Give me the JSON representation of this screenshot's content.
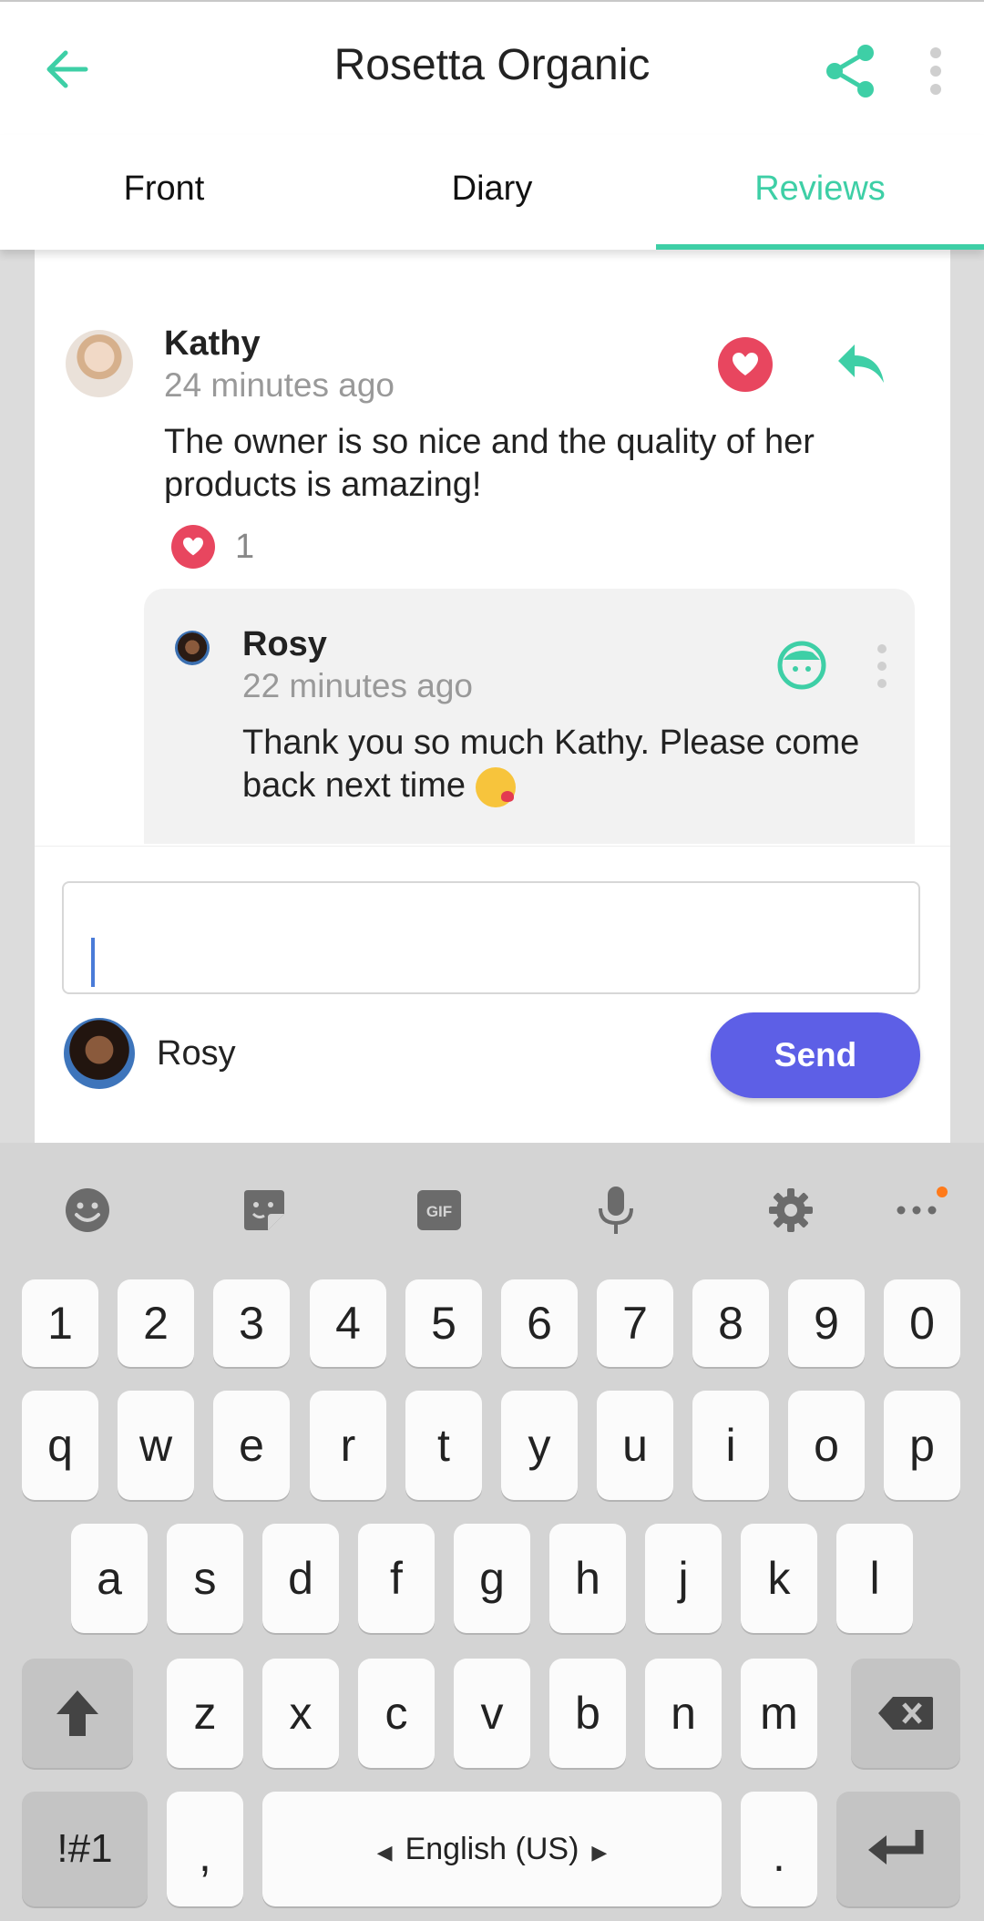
{
  "header": {
    "title": "Rosetta Organic"
  },
  "tabs": [
    {
      "label": "Front"
    },
    {
      "label": "Diary"
    },
    {
      "label": "Reviews"
    }
  ],
  "review": {
    "author": "Kathy",
    "time": "24 minutes ago",
    "text": "The owner is so nice and the quality of her products is amazing!",
    "likes": "1"
  },
  "reply": {
    "author": "Rosy",
    "time": "22 minutes ago",
    "text": "Thank you so much Kathy. Please come back next time"
  },
  "compose": {
    "user": "Rosy",
    "input_value": "",
    "send_label": "Send"
  },
  "keyboard": {
    "numbers": [
      "1",
      "2",
      "3",
      "4",
      "5",
      "6",
      "7",
      "8",
      "9",
      "0"
    ],
    "row1": [
      "q",
      "w",
      "e",
      "r",
      "t",
      "y",
      "u",
      "i",
      "o",
      "p"
    ],
    "row2": [
      "a",
      "s",
      "d",
      "f",
      "g",
      "h",
      "j",
      "k",
      "l"
    ],
    "row3": [
      "z",
      "x",
      "c",
      "v",
      "b",
      "n",
      "m"
    ],
    "symbols_label": "!#1",
    "comma": ",",
    "space_label": "English (US)",
    "period": "."
  },
  "colors": {
    "accent": "#3ecfa6",
    "heart": "#e8465f",
    "send": "#5d5fe6"
  }
}
